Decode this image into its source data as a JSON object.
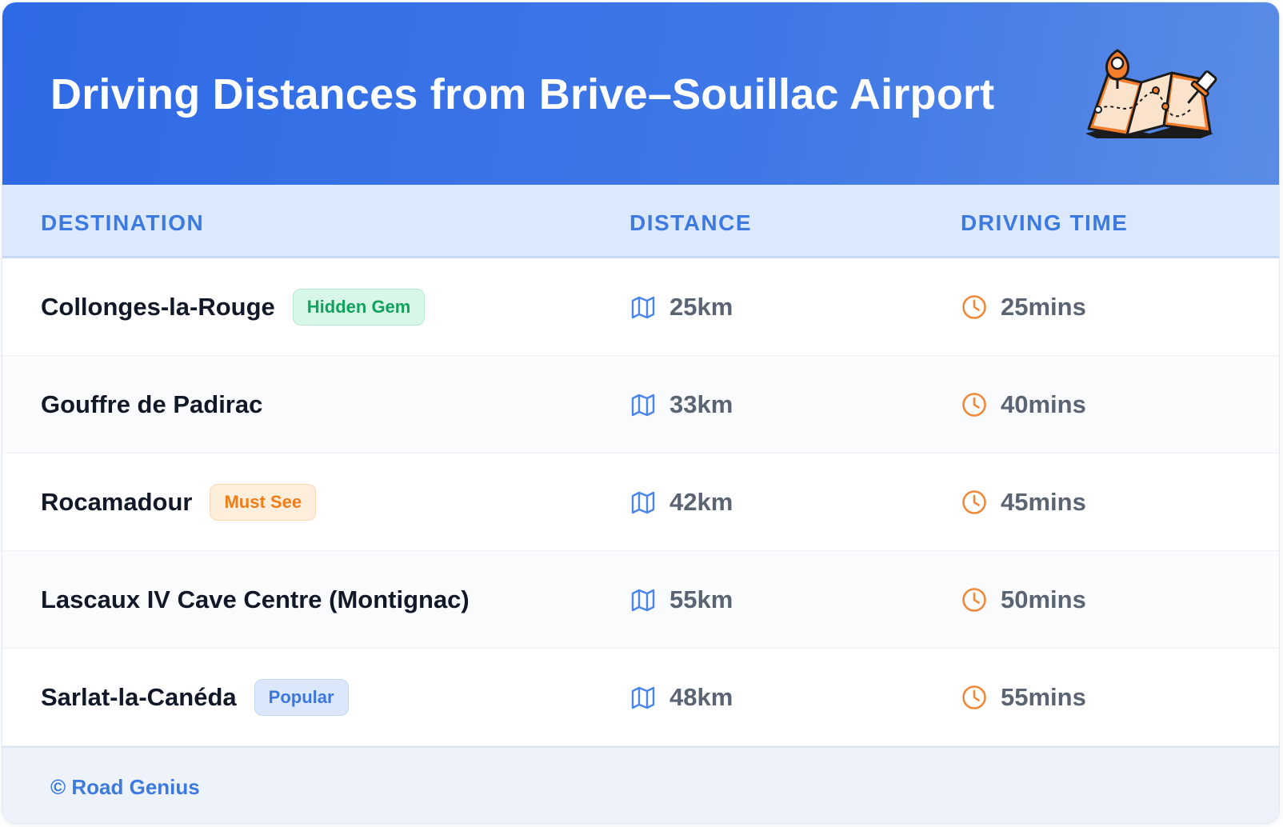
{
  "header": {
    "title": "Driving Distances from Brive–Souillac Airport",
    "illustration_icon": "map-with-pin-icon"
  },
  "table": {
    "columns": [
      "DESTINATION",
      "DISTANCE",
      "DRIVING TIME"
    ],
    "distance_icon": "map-icon",
    "time_icon": "clock-icon",
    "rows": [
      {
        "destination": "Collonges-la-Rouge",
        "badge": "Hidden Gem",
        "badge_color": "#11a35e",
        "distance": "25km",
        "time": "25mins"
      },
      {
        "destination": "Gouffre de Padirac",
        "badge": "",
        "distance": "33km",
        "time": "40mins"
      },
      {
        "destination": "Rocamadour",
        "badge": "Must See",
        "badge_color": "#ef7d1a",
        "distance": "42km",
        "time": "45mins"
      },
      {
        "destination": "Lascaux IV Cave Centre (Montignac)",
        "badge": "",
        "distance": "55km",
        "time": "50mins"
      },
      {
        "destination": "Sarlat-la-Canéda",
        "badge": "Popular",
        "badge_color": "#3d77dd",
        "distance": "48km",
        "time": "55mins"
      }
    ]
  },
  "footer": {
    "credit": "© Road Genius"
  },
  "colors": {
    "header_gradient_start": "#2f6ae6",
    "header_gradient_end": "#5a8ce6",
    "accent_blue": "#3d7ae0",
    "icon_blue": "#4a86e8",
    "icon_orange": "#f0883a"
  }
}
